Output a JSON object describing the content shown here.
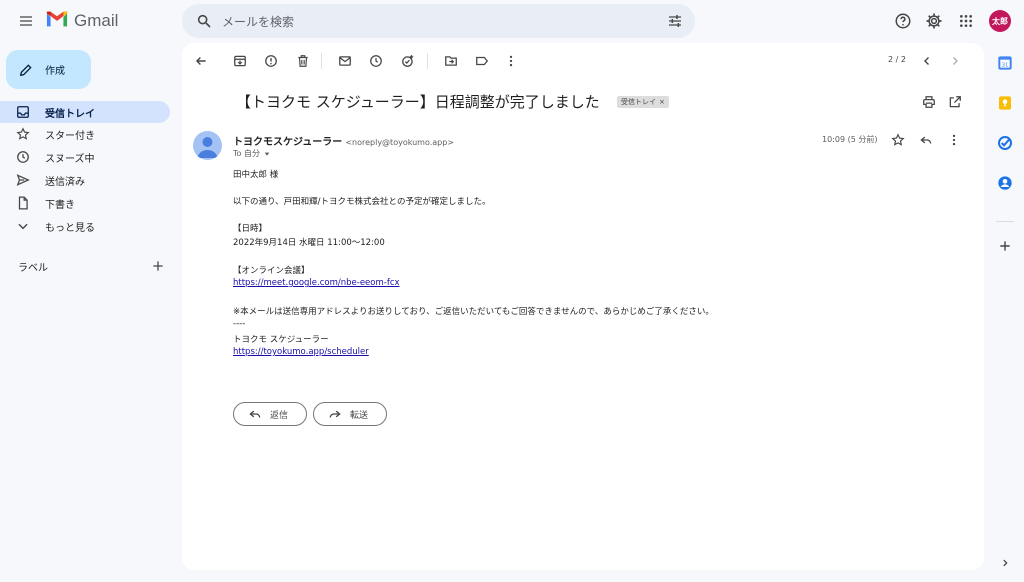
{
  "app": {
    "name": "Gmail"
  },
  "search": {
    "placeholder": "メールを検索"
  },
  "user": {
    "avatar_text": "太郎",
    "avatar_color": "#c2185b"
  },
  "sidebar": {
    "compose_label": "作成",
    "items": [
      {
        "label": "受信トレイ",
        "icon": "inbox-icon",
        "active": true
      },
      {
        "label": "スター付き",
        "icon": "star-icon"
      },
      {
        "label": "スヌーズ中",
        "icon": "clock-icon"
      },
      {
        "label": "送信済み",
        "icon": "send-icon"
      },
      {
        "label": "下書き",
        "icon": "draft-icon"
      },
      {
        "label": "もっと見る",
        "icon": "chevron-down-icon"
      }
    ],
    "labels_heading": "ラベル"
  },
  "toolbar": {
    "pager": "2 / 2"
  },
  "email": {
    "subject": "【トヨクモ スケジューラー】日程調整が完了しました",
    "tag": "受信トレイ",
    "sender_name": "トヨクモスケジューラー",
    "sender_email": "<noreply@toyokumo.app>",
    "to": "To 自分",
    "time": "10:09 (5 分前)",
    "body": {
      "greeting": "田中太郎 様",
      "intro": "以下の通り、戸田和輝/トヨクモ株式会社との予定が確定しました。",
      "datetime_heading": "【日時】",
      "datetime": "2022年9月14日 水曜日 11:00〜12:00",
      "meeting_heading": "【オンライン会議】",
      "meeting_link": "https://meet.google.com/nbe-eeom-fcx",
      "notice": "※本メールは送信専用アドレスよりお送りしており、ご返信いただいてもご回答できませんので、あらかじめご了承ください。",
      "separator": "----",
      "signature": "トヨクモ スケジューラー",
      "signature_link": "https://toyokumo.app/scheduler"
    },
    "reply_label": "返信",
    "forward_label": "転送"
  },
  "colors": {
    "accent": "#0b57d0",
    "active_nav": "#d3e3fd",
    "compose": "#c2e7ff"
  }
}
